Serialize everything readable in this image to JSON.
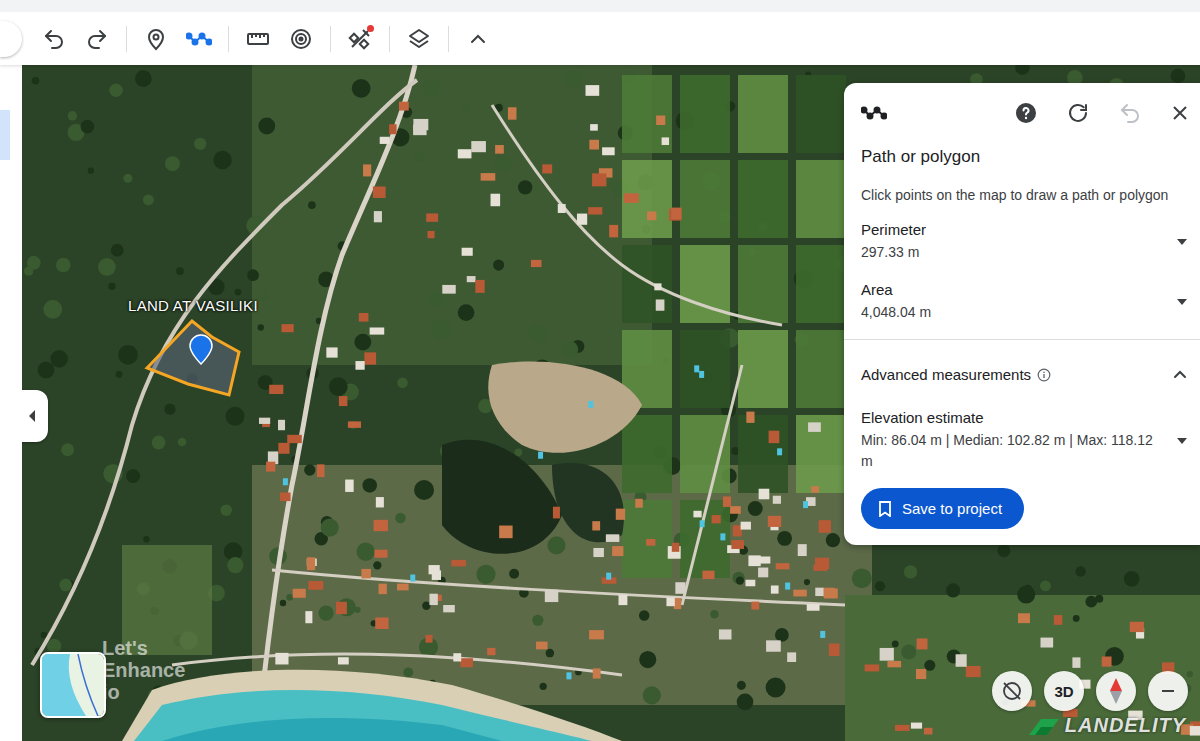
{
  "toolbar": {
    "groups": [
      [
        {
          "kind": "undo",
          "selected": false,
          "badge": false
        },
        {
          "kind": "redo",
          "selected": false,
          "badge": false
        }
      ],
      [
        {
          "kind": "pin",
          "selected": false,
          "badge": false
        },
        {
          "kind": "path",
          "selected": true,
          "badge": false
        }
      ],
      [
        {
          "kind": "ruler",
          "selected": false,
          "badge": false
        },
        {
          "kind": "radius",
          "selected": false,
          "badge": false
        }
      ],
      [
        {
          "kind": "satellite",
          "selected": false,
          "badge": true
        }
      ],
      [
        {
          "kind": "layers",
          "selected": false,
          "badge": false
        }
      ],
      [
        {
          "kind": "collapse",
          "selected": false,
          "badge": false
        }
      ]
    ]
  },
  "sidebar": {
    "items": [
      {
        "selected": true
      }
    ]
  },
  "map": {
    "parcel": {
      "label": "LAND AT VASILIKI"
    },
    "watermark": [
      "Let's",
      "Enhance",
      "io"
    ],
    "brand": "LANDELITY",
    "controls": [
      {
        "kind": "no-rotate",
        "label": ""
      },
      {
        "kind": "3d",
        "label": "3D"
      },
      {
        "kind": "compass",
        "label": ""
      },
      {
        "kind": "zoom-out",
        "label": ""
      }
    ]
  },
  "panel": {
    "title": "Path or polygon",
    "instruction": "Click points on the map to draw a path or polygon",
    "undo_disabled": true,
    "measurements": [
      {
        "label": "Perimeter",
        "value": "297.33 m",
        "expanded": false
      },
      {
        "label": "Area",
        "value": "4,048.04 m",
        "expanded": false
      }
    ],
    "advanced": {
      "label": "Advanced measurements",
      "expanded": true,
      "items": [
        {
          "label": "Elevation estimate",
          "value": "Min: 86.04 m | Median: 102.82 m | Max: 118.12 m",
          "expanded": false
        }
      ]
    },
    "button": "Save to project"
  }
}
